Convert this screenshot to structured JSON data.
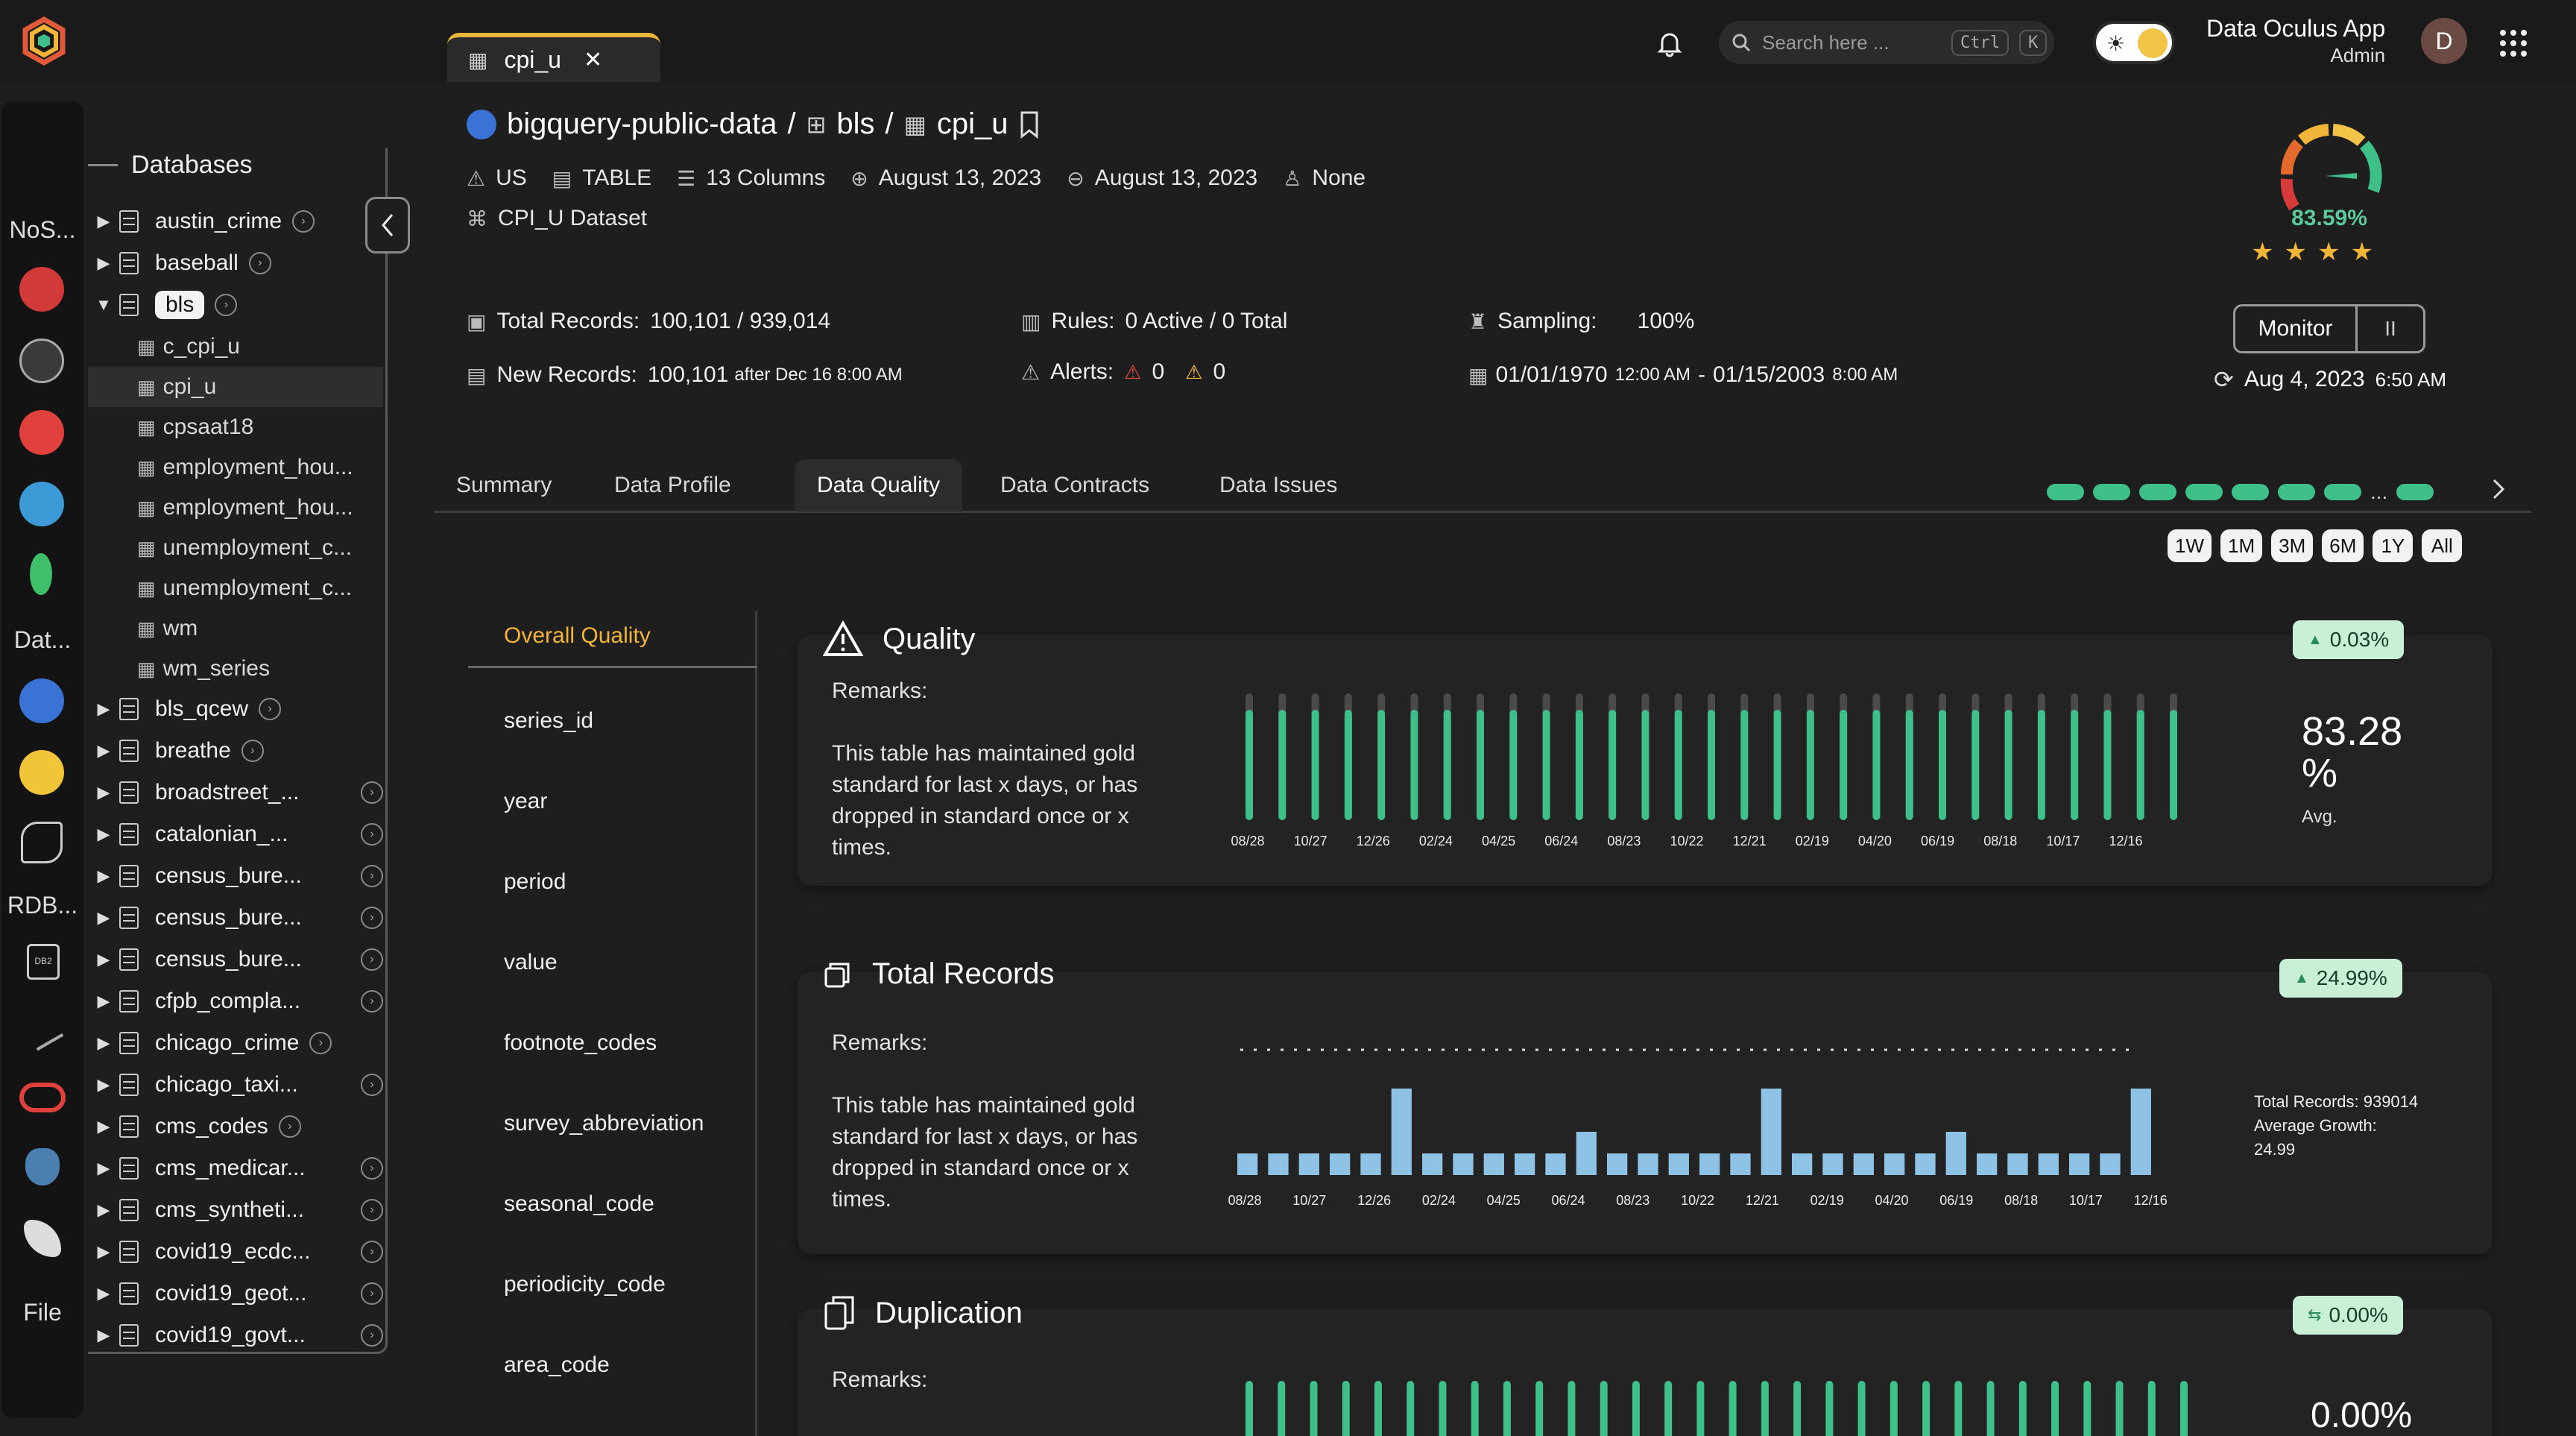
{
  "app": {
    "tab_label": "cpi_u",
    "search_placeholder": "Search here ...",
    "kbd_ctrl": "Ctrl",
    "kbd_k": "K",
    "user_name": "Data Oculus App",
    "user_role": "Admin",
    "avatar_initial": "D"
  },
  "rail": {
    "nosql_label": "NoS...",
    "data_label": "Dat...",
    "rdb_label": "RDB...",
    "file_label": "File"
  },
  "databases": {
    "title": "Databases",
    "items": [
      {
        "label": "austin_crime"
      },
      {
        "label": "baseball"
      },
      {
        "label": "bls"
      },
      {
        "label": "bls_qcew"
      },
      {
        "label": "breathe"
      },
      {
        "label": "broadstreet_..."
      },
      {
        "label": "catalonian_..."
      },
      {
        "label": "census_bure..."
      },
      {
        "label": "census_bure..."
      },
      {
        "label": "census_bure..."
      },
      {
        "label": "cfpb_compla..."
      },
      {
        "label": "chicago_crime"
      },
      {
        "label": "chicago_taxi..."
      },
      {
        "label": "cms_codes"
      },
      {
        "label": "cms_medicar..."
      },
      {
        "label": "cms_syntheti..."
      },
      {
        "label": "covid19_ecdc..."
      },
      {
        "label": "covid19_geot..."
      },
      {
        "label": "covid19_govt..."
      }
    ],
    "bls_tables": [
      "c_cpi_u",
      "cpi_u",
      "cpsaat18",
      "employment_hou...",
      "employment_hou...",
      "unemployment_c...",
      "unemployment_c...",
      "wm",
      "wm_series"
    ]
  },
  "header": {
    "project": "bigquery-public-data",
    "dataset": "bls",
    "table": "cpi_u",
    "region": "US",
    "type": "TABLE",
    "columns": "13 Columns",
    "created": "August 13, 2023",
    "modified": "August 13, 2023",
    "owner": "None",
    "description": "CPI_U Dataset"
  },
  "score": {
    "value": "83.59%",
    "stars": 4
  },
  "stats": {
    "total_records_label": "Total Records:",
    "total_records_value": "100,101 / 939,014",
    "new_records_label": "New Records:",
    "new_records_value": "100,101",
    "new_records_suffix": "after Dec 16 8:00 AM",
    "rules_label": "Rules:",
    "rules_value": "0 Active / 0 Total",
    "alerts_label": "Alerts:",
    "alerts_high": "0",
    "alerts_warn": "0",
    "sampling_label": "Sampling:",
    "sampling_value": "100%",
    "range_start": "01/01/1970",
    "range_start_time": "12:00 AM",
    "range_sep": "-",
    "range_end": "01/15/2003",
    "range_end_time": "8:00 AM",
    "monitor_label": "Monitor",
    "pause_label": "II",
    "last_run": "Aug 4, 2023",
    "last_run_time": "6:50 AM"
  },
  "tabs": [
    "Summary",
    "Data Profile",
    "Data Quality",
    "Data Contracts",
    "Data Issues"
  ],
  "run_dots_ellipsis": "...",
  "ranges": [
    "1W",
    "1M",
    "3M",
    "6M",
    "1Y",
    "All"
  ],
  "quality_nav": [
    "Overall Quality",
    "series_id",
    "year",
    "period",
    "value",
    "footnote_codes",
    "survey_abbreviation",
    "seasonal_code",
    "periodicity_code",
    "area_code"
  ],
  "cards": {
    "quality": {
      "title": "Quality",
      "badge": "0.03%",
      "remarks_label": "Remarks:",
      "remarks": "This table has maintained gold standard for last x days, or has dropped in standard once or x times.",
      "big_value": "83.28",
      "big_unit": "%",
      "big_caption": "Avg."
    },
    "records": {
      "title": "Total Records",
      "badge": "24.99%",
      "remarks_label": "Remarks:",
      "remarks": "This table has maintained gold standard for last x days, or has dropped in standard once or x times.",
      "summary_total": "Total Records: 939014",
      "summary_growth_label": "Average Growth:",
      "summary_growth_value": "24.99"
    },
    "duplication": {
      "title": "Duplication",
      "badge": "0.00%",
      "remarks_label": "Remarks:",
      "big_value": "0.00%"
    }
  },
  "chart_data": [
    {
      "type": "bar",
      "title": "Quality",
      "categories": [
        "08/28",
        "",
        "10/27",
        "",
        "12/26",
        "",
        "02/24",
        "",
        "04/25",
        "",
        "06/24",
        "",
        "08/23",
        "",
        "10/22",
        "",
        "12/21",
        "",
        "02/19",
        "",
        "04/20",
        "",
        "06/19",
        "",
        "08/18",
        "",
        "10/17",
        "",
        "12/16",
        ""
      ],
      "x_ticks": [
        "08/28",
        "10/27",
        "12/26",
        "02/24",
        "04/25",
        "06/24",
        "08/23",
        "10/22",
        "12/21",
        "02/19",
        "04/20",
        "06/19",
        "08/18",
        "10/17",
        "12/16"
      ],
      "values": [
        83,
        83,
        83,
        83,
        83,
        83,
        83,
        83,
        83,
        83,
        83,
        83,
        83,
        83,
        83,
        83,
        83,
        83,
        83,
        83,
        83,
        83,
        83,
        83,
        83,
        83,
        83,
        83,
        83
      ],
      "ylim": [
        0,
        100
      ],
      "colors": {
        "bar": "#3fbf8a",
        "track": "#4a4a4a"
      }
    },
    {
      "type": "bar",
      "title": "Total Records",
      "x_ticks": [
        "08/28",
        "10/27",
        "12/26",
        "02/24",
        "04/25",
        "06/24",
        "08/23",
        "10/22",
        "12/21",
        "02/19",
        "04/20",
        "06/19",
        "08/18",
        "10/17",
        "12/16"
      ],
      "values": [
        1,
        1,
        1,
        1,
        1,
        4,
        1,
        1,
        1,
        1,
        1,
        2,
        1,
        1,
        1,
        1,
        1,
        4,
        1,
        1,
        1,
        1,
        1,
        2,
        1,
        1,
        1,
        1,
        1,
        4
      ],
      "colors": {
        "bar": "#8ec3e6",
        "baseline": "#dddddd"
      }
    },
    {
      "type": "bar",
      "title": "Duplication",
      "values": [
        0,
        0,
        0,
        0,
        0,
        0,
        0,
        0,
        0,
        0,
        0,
        0,
        0,
        0,
        0,
        0,
        0,
        0,
        0,
        0,
        0,
        0,
        0,
        0,
        0,
        0,
        0,
        0,
        0,
        0
      ],
      "colors": {
        "bar": "#3fbf8a"
      }
    }
  ],
  "colors": {
    "accent": "#f2b53a",
    "good": "#3fbf8a",
    "badge_bg": "#c9f0d7",
    "background": "#1e1e1e"
  }
}
